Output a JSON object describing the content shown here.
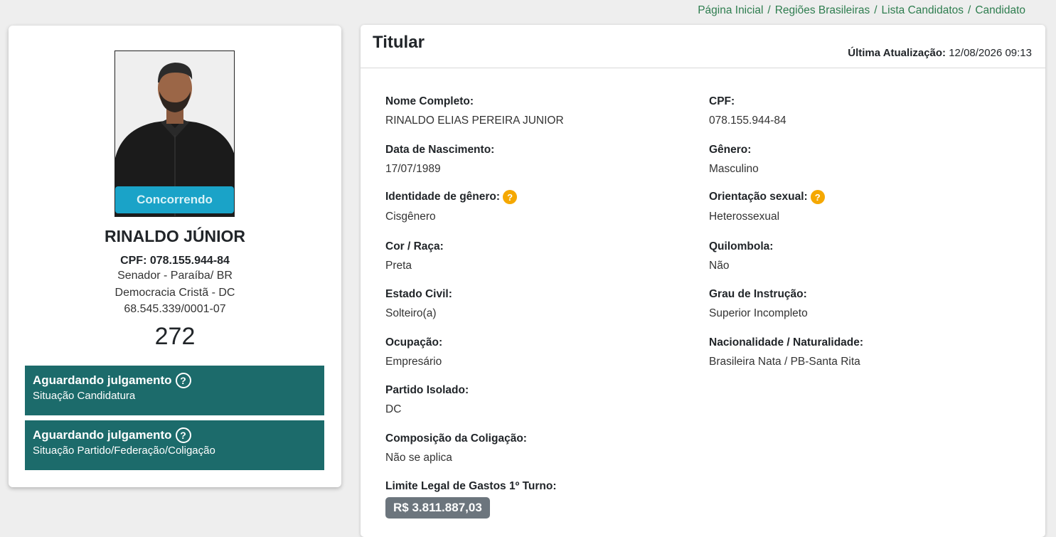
{
  "breadcrumb": {
    "items": [
      "Página Inicial",
      "Regiões Brasileiras",
      "Lista Candidatos"
    ],
    "current": "Candidato",
    "separator": "/"
  },
  "candidate": {
    "photo_status": "Concorrendo",
    "name": "RINALDO JÚNIOR",
    "cpf_line": "CPF: 078.155.944-84",
    "office": "Senador - Paraíba/ BR",
    "party": "Democracia Cristã - DC",
    "cnpj": "68.545.339/0001-07",
    "number": "272"
  },
  "status_boxes": [
    {
      "title": "Aguardando julgamento",
      "subtitle": "Situação Candidatura"
    },
    {
      "title": "Aguardando julgamento",
      "subtitle": "Situação Partido/Federação/Coligação"
    }
  ],
  "details": {
    "title": "Titular",
    "updated_label": "Última Atualização:",
    "updated_value": "12/08/2026 09:13",
    "fields": {
      "nome_label": "Nome Completo:",
      "nome_value": "RINALDO ELIAS PEREIRA JUNIOR",
      "cpf_label": "CPF:",
      "cpf_value": "078.155.944-84",
      "nasc_label": "Data de Nascimento:",
      "nasc_value": "17/07/1989",
      "genero_label": "Gênero:",
      "genero_value": "Masculino",
      "ident_label": "Identidade de gênero:",
      "ident_value": "Cisgênero",
      "orient_label": "Orientação sexual:",
      "orient_value": "Heterossexual",
      "cor_label": "Cor / Raça:",
      "cor_value": "Preta",
      "quil_label": "Quilombola:",
      "quil_value": "Não",
      "civil_label": "Estado Civil:",
      "civil_value": "Solteiro(a)",
      "grau_label": "Grau de Instrução:",
      "grau_value": "Superior Incompleto",
      "ocup_label": "Ocupação:",
      "ocup_value": "Empresário",
      "nac_label": "Nacionalidade / Naturalidade:",
      "nac_value": "Brasileira Nata / PB-Santa Rita",
      "partido_label": "Partido Isolado:",
      "partido_value": "DC",
      "comp_label": "Composição da Coligação:",
      "comp_value": "Não se aplica",
      "limite_label": "Limite Legal de Gastos 1º Turno:",
      "limite_value": "R$ 3.811.887,03"
    },
    "help_glyph": "?"
  },
  "colors": {
    "accent_green": "#2e7d4f",
    "status_teal": "#1c6b6b",
    "ribbon_blue": "#1aa3c8",
    "help_orange": "#f5a800",
    "money_gray": "#6c757d"
  },
  "icons": [
    "help-circle-icon",
    "question-badge-icon"
  ]
}
